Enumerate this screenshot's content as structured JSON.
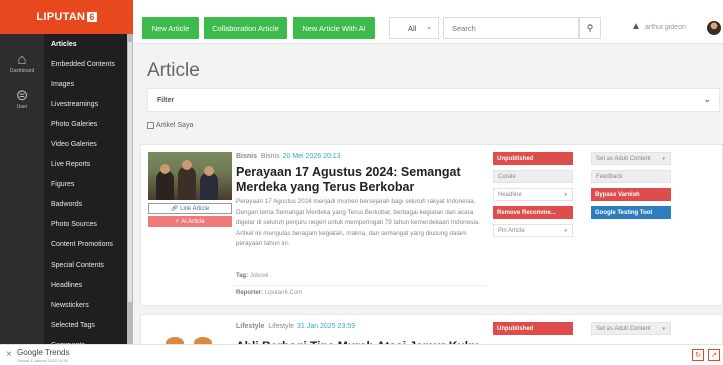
{
  "brand": {
    "name": "LIPUTAN",
    "badge": "6"
  },
  "rail": [
    {
      "label": "Dashboard",
      "icon": "home-icon",
      "glyph": "⌂"
    },
    {
      "label": "User",
      "icon": "user-icon",
      "glyph": "⊜"
    }
  ],
  "menu": {
    "items": [
      "Articles",
      "Embedded Contents",
      "Images",
      "Livestreamings",
      "Photo Galeries",
      "Video Galeries",
      "Live Reports",
      "Figures",
      "Badwords",
      "Photo Sources",
      "Content Promotions",
      "Special Contents",
      "Headlines",
      "Newstickers",
      "Selected Tags",
      "Comments"
    ],
    "active": "Articles"
  },
  "toolbar": {
    "new_article": "New Article",
    "collab_article": "Collaboration Article",
    "new_article_ai": "New Article With AI",
    "select_value": "All",
    "search_placeholder": "Search",
    "username": "arthur.gideon"
  },
  "page": {
    "title": "Article",
    "filter_label": "Filter",
    "my_articles_label": "Artikel Saya"
  },
  "articles": [
    {
      "category": "Bisnis",
      "subcategory": "Bisnis",
      "date": "20 Mei 2026 20:13",
      "title": "Perayaan 17 Agustus 2024: Semangat Merdeka yang Terus Berkobar",
      "description": "Perayaan 17 Agustus 2024 menjadi momen bersejarah bagi seluruh rakyat Indonesia. Dengan tema Semangat Merdeka yang Terus Berkobar, berbagai kegiatan dan acara digelar di seluruh penjuru negeri untuk memperingati 79 tahun kemerdekaan Indonesia. Artikel ini mengulas beragam kegiatan, makna, dan semangat yang diusung dalam perayaan tahun ini.",
      "tag_label": "Tag:",
      "tag": "Jokowi",
      "reporter_label": "Reporter:",
      "reporter": "Liputan6.Com",
      "link_label": "Link Article",
      "ai_label": "AI Article",
      "status": "Unpublished",
      "curate": "Curate",
      "headline": "Headline",
      "remove_recommend": "Remove Recomme...",
      "pin": "Pin Article",
      "adult": "Set as Adult Content",
      "feedback": "Feedback",
      "bypass": "Bypass Varnish",
      "google_tool": "Google Testing Tool"
    },
    {
      "category": "Lifestyle",
      "subcategory": "Lifestyle",
      "date": "31 Jan 2025 23:59",
      "title": "Ahli Berbagi Tips Murah Atasi Jamur Kuku",
      "status": "Unpublished",
      "adult": "Set as Adult Content"
    }
  ],
  "notification": {
    "title": "Google Trends",
    "subtitle": "Sesuai 8 Januari 2025 13:30"
  }
}
